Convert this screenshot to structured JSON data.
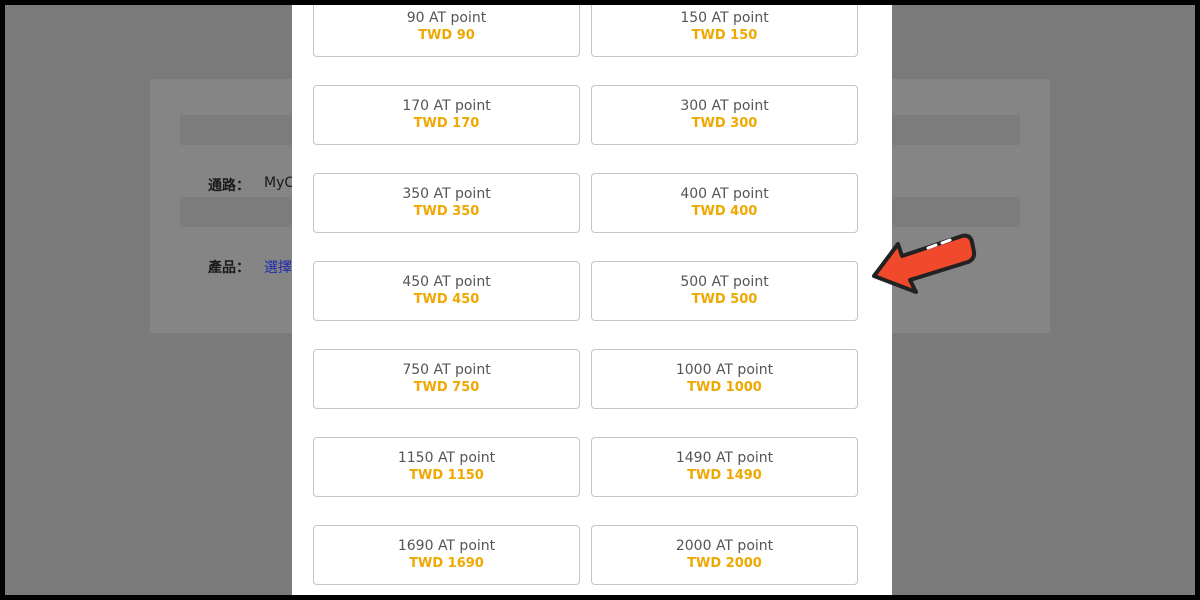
{
  "background": {
    "channel_label": "通路：",
    "channel_value": "MyC",
    "product_label": "產品：",
    "product_value": "選擇"
  },
  "options": [
    {
      "points": "90 AT point",
      "price": "TWD 90"
    },
    {
      "points": "150 AT point",
      "price": "TWD 150"
    },
    {
      "points": "170 AT point",
      "price": "TWD 170"
    },
    {
      "points": "300 AT point",
      "price": "TWD 300"
    },
    {
      "points": "350 AT point",
      "price": "TWD 350"
    },
    {
      "points": "400 AT point",
      "price": "TWD 400"
    },
    {
      "points": "450 AT point",
      "price": "TWD 450"
    },
    {
      "points": "500 AT point",
      "price": "TWD 500"
    },
    {
      "points": "750 AT point",
      "price": "TWD 750"
    },
    {
      "points": "1000 AT point",
      "price": "TWD 1000"
    },
    {
      "points": "1150 AT point",
      "price": "TWD 1150"
    },
    {
      "points": "1490 AT point",
      "price": "TWD 1490"
    },
    {
      "points": "1690 AT point",
      "price": "TWD 1690"
    },
    {
      "points": "2000 AT point",
      "price": "TWD 2000"
    }
  ],
  "highlighted_option": "500 AT point",
  "colors": {
    "price": "#f0a800",
    "arrow": "#f0492b",
    "overlay": "#7a7a7a"
  }
}
